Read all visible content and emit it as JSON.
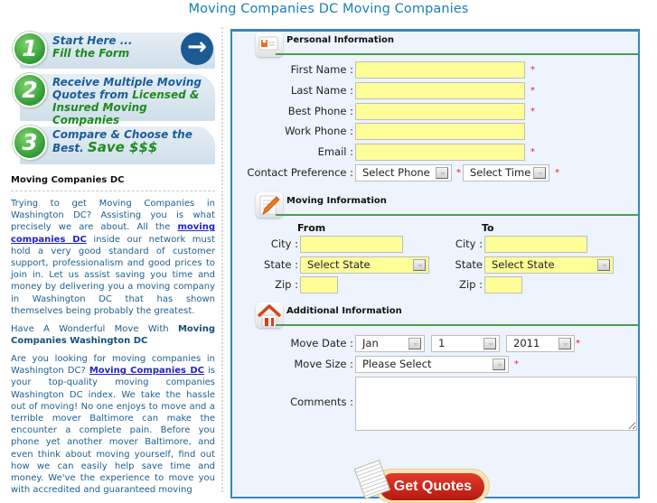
{
  "page": {
    "title": "Moving Companies DC Moving Companies"
  },
  "sidebar": {
    "steps": [
      {
        "number": "1",
        "line1": "Start Here ...",
        "line2": "Fill the Form",
        "action_icon": "arrow-right-icon"
      },
      {
        "number": "2",
        "line1": "Receive Multiple Moving",
        "line2a": "Quotes from ",
        "line2b": "Licensed &",
        "line3": "Insured Moving Companies"
      },
      {
        "number": "3",
        "line1": "Compare & Choose the",
        "line2a": "Best. ",
        "line2b": "Save $$$"
      }
    ],
    "heading": "Moving Companies DC",
    "para1_before": "Trying to get Moving Companies in Washington DC? Assisting you is what precisely we are about. All the ",
    "para1_link": "moving companies DC",
    "para1_after": " inside our network must hold a very good standard of customer support, professionalism and good prices to join in. Let us assist saving you time and money by delivering you a moving company in Washington DC that has shown themselves being probably the greatest.",
    "subheading_plain": "Have A Wonderful Move With ",
    "subheading_bold": "Moving Companies Washington DC",
    "para2_before": "Are you looking for moving companies in Washington DC? ",
    "para2_link": "Moving Companies DC",
    "para2_after": " is your top-quality moving companies Washington DC index. We take the hassle out of moving! No one enjoys to move and a terrible mover Baltimore can make the encounter a complete pain. Before you phone yet another mover Baltimore, and even think about moving yourself, find out how we can easily help save time and money. We've the experience to move you with accredited and guaranteed moving"
  },
  "form": {
    "personal": {
      "title": "Personal Information",
      "icon": "contact-card-icon",
      "fields": [
        {
          "label": "First Name :",
          "value": "",
          "required": true
        },
        {
          "label": "Last Name :",
          "value": "",
          "required": true
        },
        {
          "label": "Best Phone :",
          "value": "",
          "required": true
        },
        {
          "label": "Work Phone :",
          "value": "",
          "required": false
        },
        {
          "label": "Email :",
          "value": "",
          "required": true
        }
      ],
      "contact_pref": {
        "label": "Contact Preference :",
        "phone_select": "Select Phone",
        "time_select": "Select Time"
      },
      "required_mark": "*"
    },
    "moving": {
      "title": "Moving Information",
      "icon": "pencil-note-icon",
      "from": {
        "heading": "From",
        "city_label": "City :",
        "state_label": "State :",
        "state_value": "Select State",
        "zip_label": "Zip :"
      },
      "to": {
        "heading": "To",
        "city_label": "City :",
        "state_label": "State",
        "state_value": "Select State",
        "zip_label": "Zip :"
      }
    },
    "additional": {
      "title": "Additional Information",
      "icon": "house-icon",
      "move_date_label": "Move Date :",
      "month": "Jan",
      "day": "1",
      "year": "2011",
      "move_size_label": "Move Size :",
      "move_size": "Please Select",
      "comments_label": "Comments :",
      "comments_value": ""
    },
    "submit_label": "Get Quotes"
  }
}
